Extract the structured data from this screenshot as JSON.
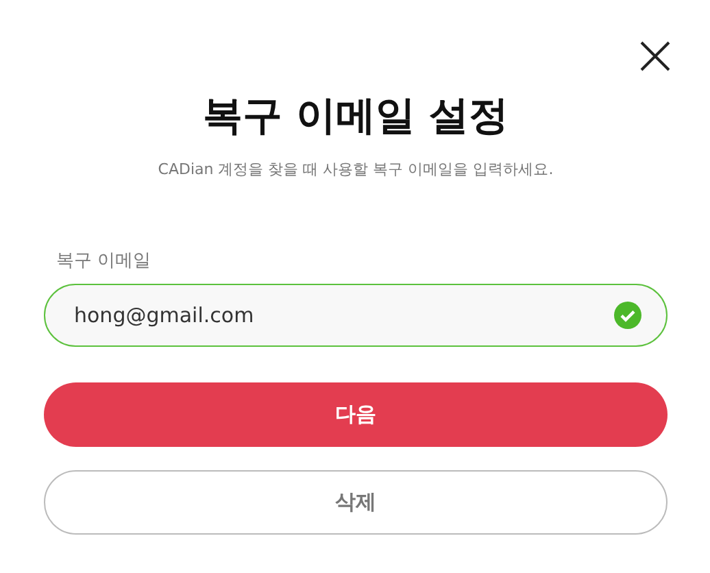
{
  "dialog": {
    "title": "복구 이메일 설정",
    "subtitle": "CADian 계정을 찾을 때 사용할 복구 이메일을 입력하세요."
  },
  "field": {
    "label": "복구 이메일",
    "value": "hong@gmail.com",
    "valid": true
  },
  "buttons": [
    {
      "label": "다음",
      "kind": "primary"
    },
    {
      "label": "삭제",
      "kind": "secondary"
    }
  ]
}
